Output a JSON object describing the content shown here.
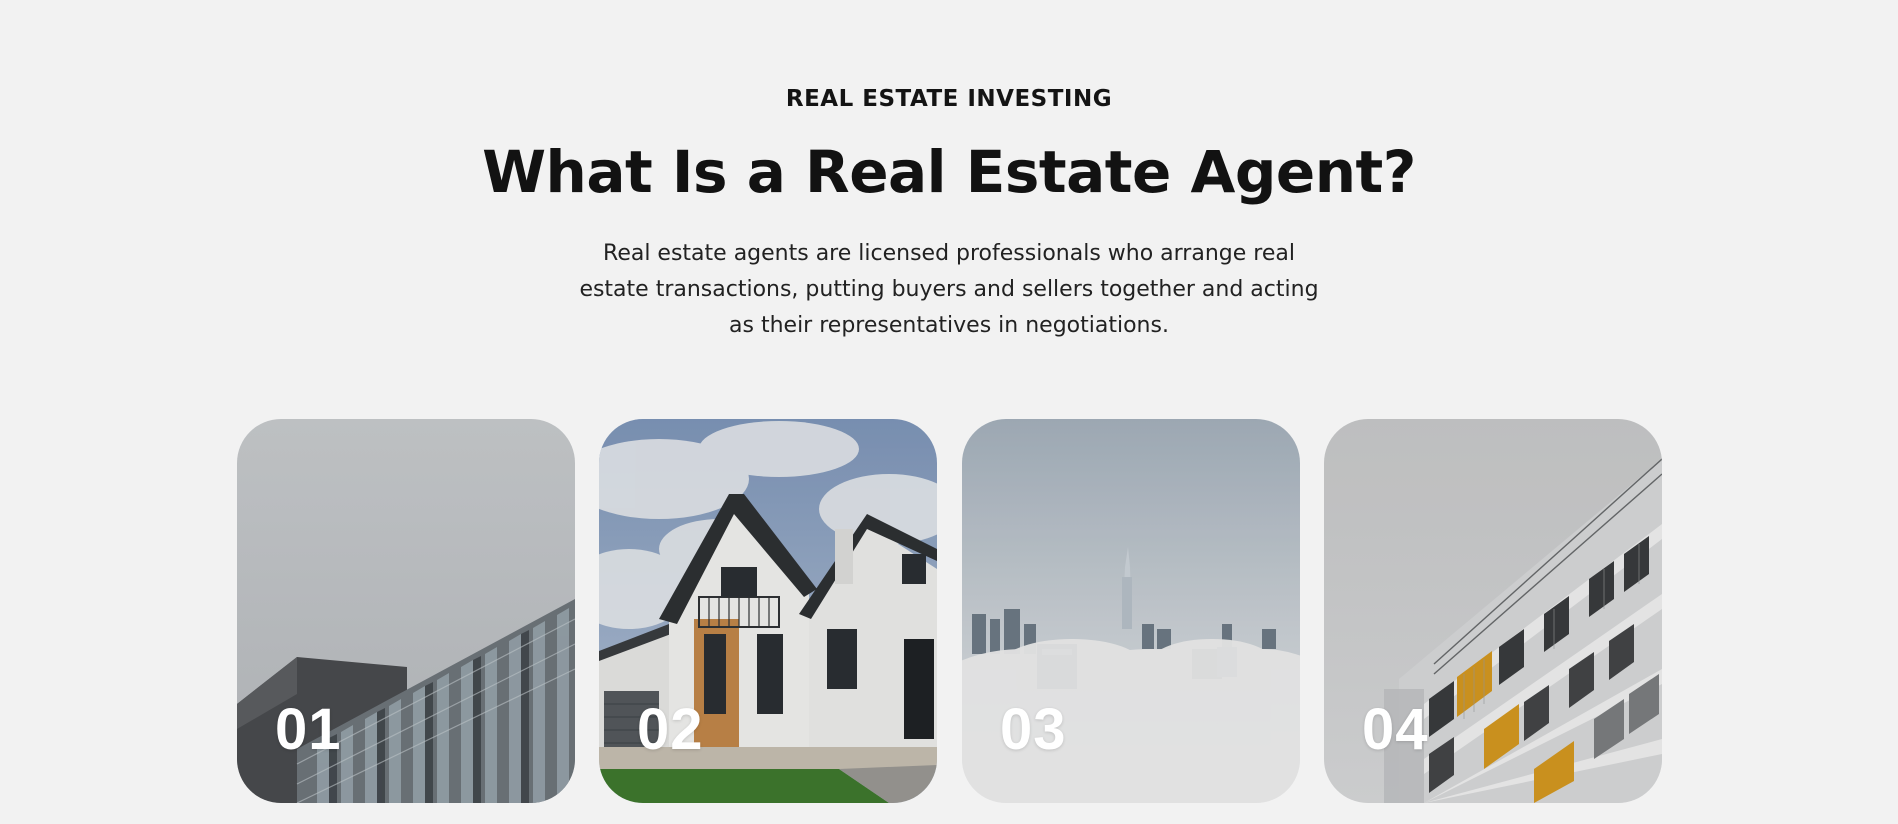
{
  "section": {
    "eyebrow": "REAL ESTATE INVESTING",
    "title": "What Is a Real Estate Agent?",
    "description": "Real estate agents are licensed professionals who arrange real estate transactions, putting buyers and sellers together and acting as their representatives in negotiations."
  },
  "cards": [
    {
      "number": "01",
      "image": "modern-glass-building-photo"
    },
    {
      "number": "02",
      "image": "white-house-photo"
    },
    {
      "number": "03",
      "image": "city-in-clouds-photo"
    },
    {
      "number": "04",
      "image": "apartment-balconies-photo"
    }
  ],
  "colors": {
    "background": "#f2f2f2",
    "heading": "#121212",
    "text": "#222222",
    "card_number": "#ffffff"
  }
}
